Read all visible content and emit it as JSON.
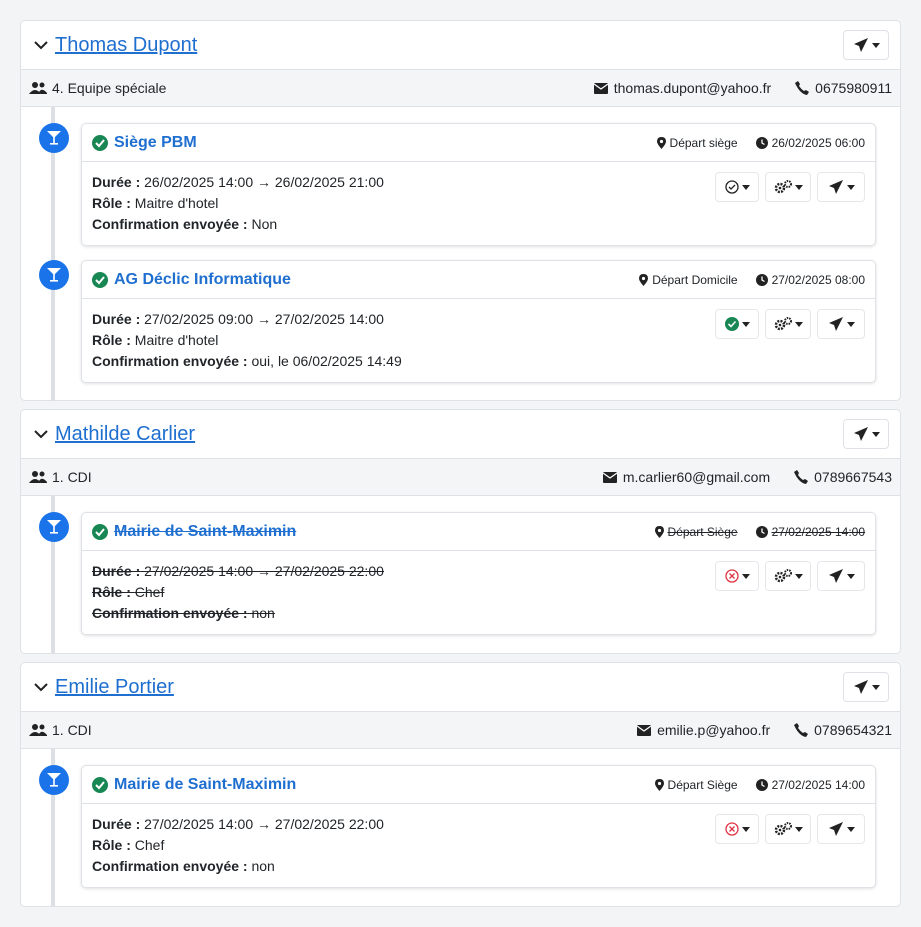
{
  "colors": {
    "accent": "#1f6fd0",
    "timeline_dot": "#1a73e8",
    "confirmed": "#198754",
    "cancelled": "#dc3545"
  },
  "persons": [
    {
      "name": "Thomas Dupont",
      "team": "4. Equipe spéciale",
      "email": "thomas.dupont@yahoo.fr",
      "phone": "0675980911",
      "events": [
        {
          "title": "Siège PBM",
          "departure": "Départ siège",
          "datetime": "26/02/2025 06:00",
          "duration_label": "Durée :",
          "duration": "26/02/2025 14:00 → 26/02/2025 21:00",
          "role_label": "Rôle :",
          "role": "Maitre d'hotel",
          "confirm_label": "Confirmation envoyée :",
          "confirm": "Non",
          "status_icon": "circle-check-outline-icon"
        },
        {
          "title": "AG Déclic Informatique",
          "departure": "Départ Domicile",
          "datetime": "27/02/2025 08:00",
          "duration_label": "Durée :",
          "duration": "27/02/2025 09:00 → 27/02/2025 14:00",
          "role_label": "Rôle :",
          "role": "Maitre d'hotel",
          "confirm_label": "Confirmation envoyée :",
          "confirm": " oui, le 06/02/2025 14:49",
          "status_icon": "circle-check-filled-icon"
        }
      ]
    },
    {
      "name": "Mathilde Carlier",
      "team": "1. CDI",
      "email": "m.carlier60@gmail.com",
      "phone": "0789667543",
      "events": [
        {
          "title": "Mairie de Saint-Maximin",
          "departure": "Départ Siège",
          "datetime": "27/02/2025 14:00",
          "duration_label": "Durée :",
          "duration": "27/02/2025 14:00 → 27/02/2025 22:00",
          "role_label": "Rôle :",
          "role": "Chef",
          "confirm_label": "Confirmation envoyée :",
          "confirm": "non",
          "status_icon": "circle-x-icon",
          "cancelled": true
        }
      ]
    },
    {
      "name": "Emilie Portier",
      "team": "1. CDI",
      "email": "emilie.p@yahoo.fr",
      "phone": "0789654321",
      "events": [
        {
          "title": "Mairie de Saint-Maximin",
          "departure": "Départ Siège",
          "datetime": "27/02/2025 14:00",
          "duration_label": "Durée :",
          "duration": "27/02/2025 14:00 → 27/02/2025 22:00",
          "role_label": "Rôle :",
          "role": "Chef",
          "confirm_label": "Confirmation envoyée :",
          "confirm": "non",
          "status_icon": "circle-x-icon"
        }
      ]
    }
  ]
}
